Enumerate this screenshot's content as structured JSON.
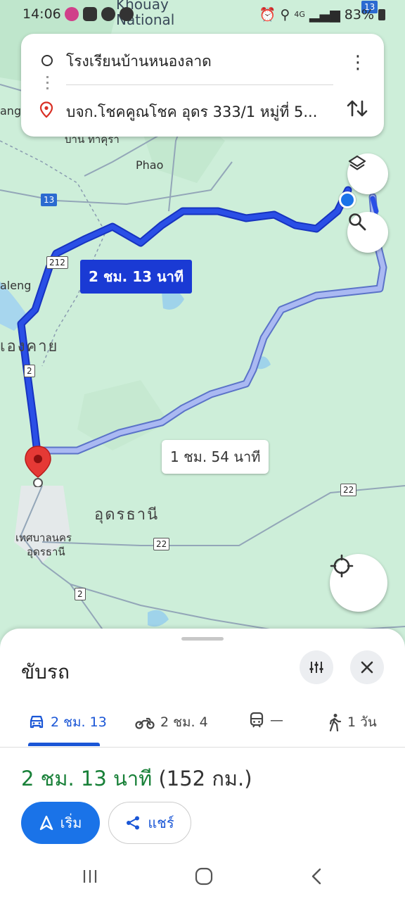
{
  "status_bar": {
    "time": "14:06",
    "network": "4G",
    "battery": "83%",
    "icons": [
      "lite-app-icon",
      "gallery-icon",
      "line-icon",
      "messages-icon",
      "alarm-icon",
      "location-icon",
      "signal-icon",
      "battery-icon"
    ]
  },
  "search": {
    "origin": "โรงเรียนบ้านหนองลาด",
    "destination": "บจก.โชคคูณโชค อุดร 333/1 หมู่ที่ 5..."
  },
  "map": {
    "place_labels": {
      "khouay": "Khouay",
      "national": "National",
      "ang": "ang",
      "ban_label": "บ้าน ทาคุรา",
      "phao": "Phao",
      "aleng": "aleng",
      "nongkhai": "เองคาย",
      "udon": "อุดรธานี",
      "udon_city_1": "เทศบาลนคร",
      "udon_city_2": "อุดรธานี"
    },
    "road_shields": {
      "r13_top": "13",
      "r13": "13",
      "r212": "212",
      "r2a": "2",
      "r22a": "22",
      "r22b": "22",
      "r2b": "2"
    },
    "route_main_label": "2 ชม. 13 นาที",
    "route_alt_label": "1 ชม. 54 นาที",
    "colors": {
      "route_main": "#1a3ad4",
      "route_alt": "#a7b8f0",
      "map_bg": "#cdeed9",
      "pin": "#e53935"
    }
  },
  "sheet": {
    "title": "ขับรถ",
    "modes": [
      {
        "icon": "car-icon",
        "label": "2 ชม. 13",
        "active": true
      },
      {
        "icon": "motorcycle-icon",
        "label": "2 ชม. 4",
        "active": false
      },
      {
        "icon": "transit-icon",
        "label": "—",
        "active": false
      },
      {
        "icon": "walk-icon",
        "label": "1 วัน",
        "active": false
      }
    ],
    "summary_duration": "2 ชม. 13 นาที",
    "summary_distance": "(152 กม.)",
    "start_label": "เริ่ม",
    "share_label": "แชร์"
  }
}
